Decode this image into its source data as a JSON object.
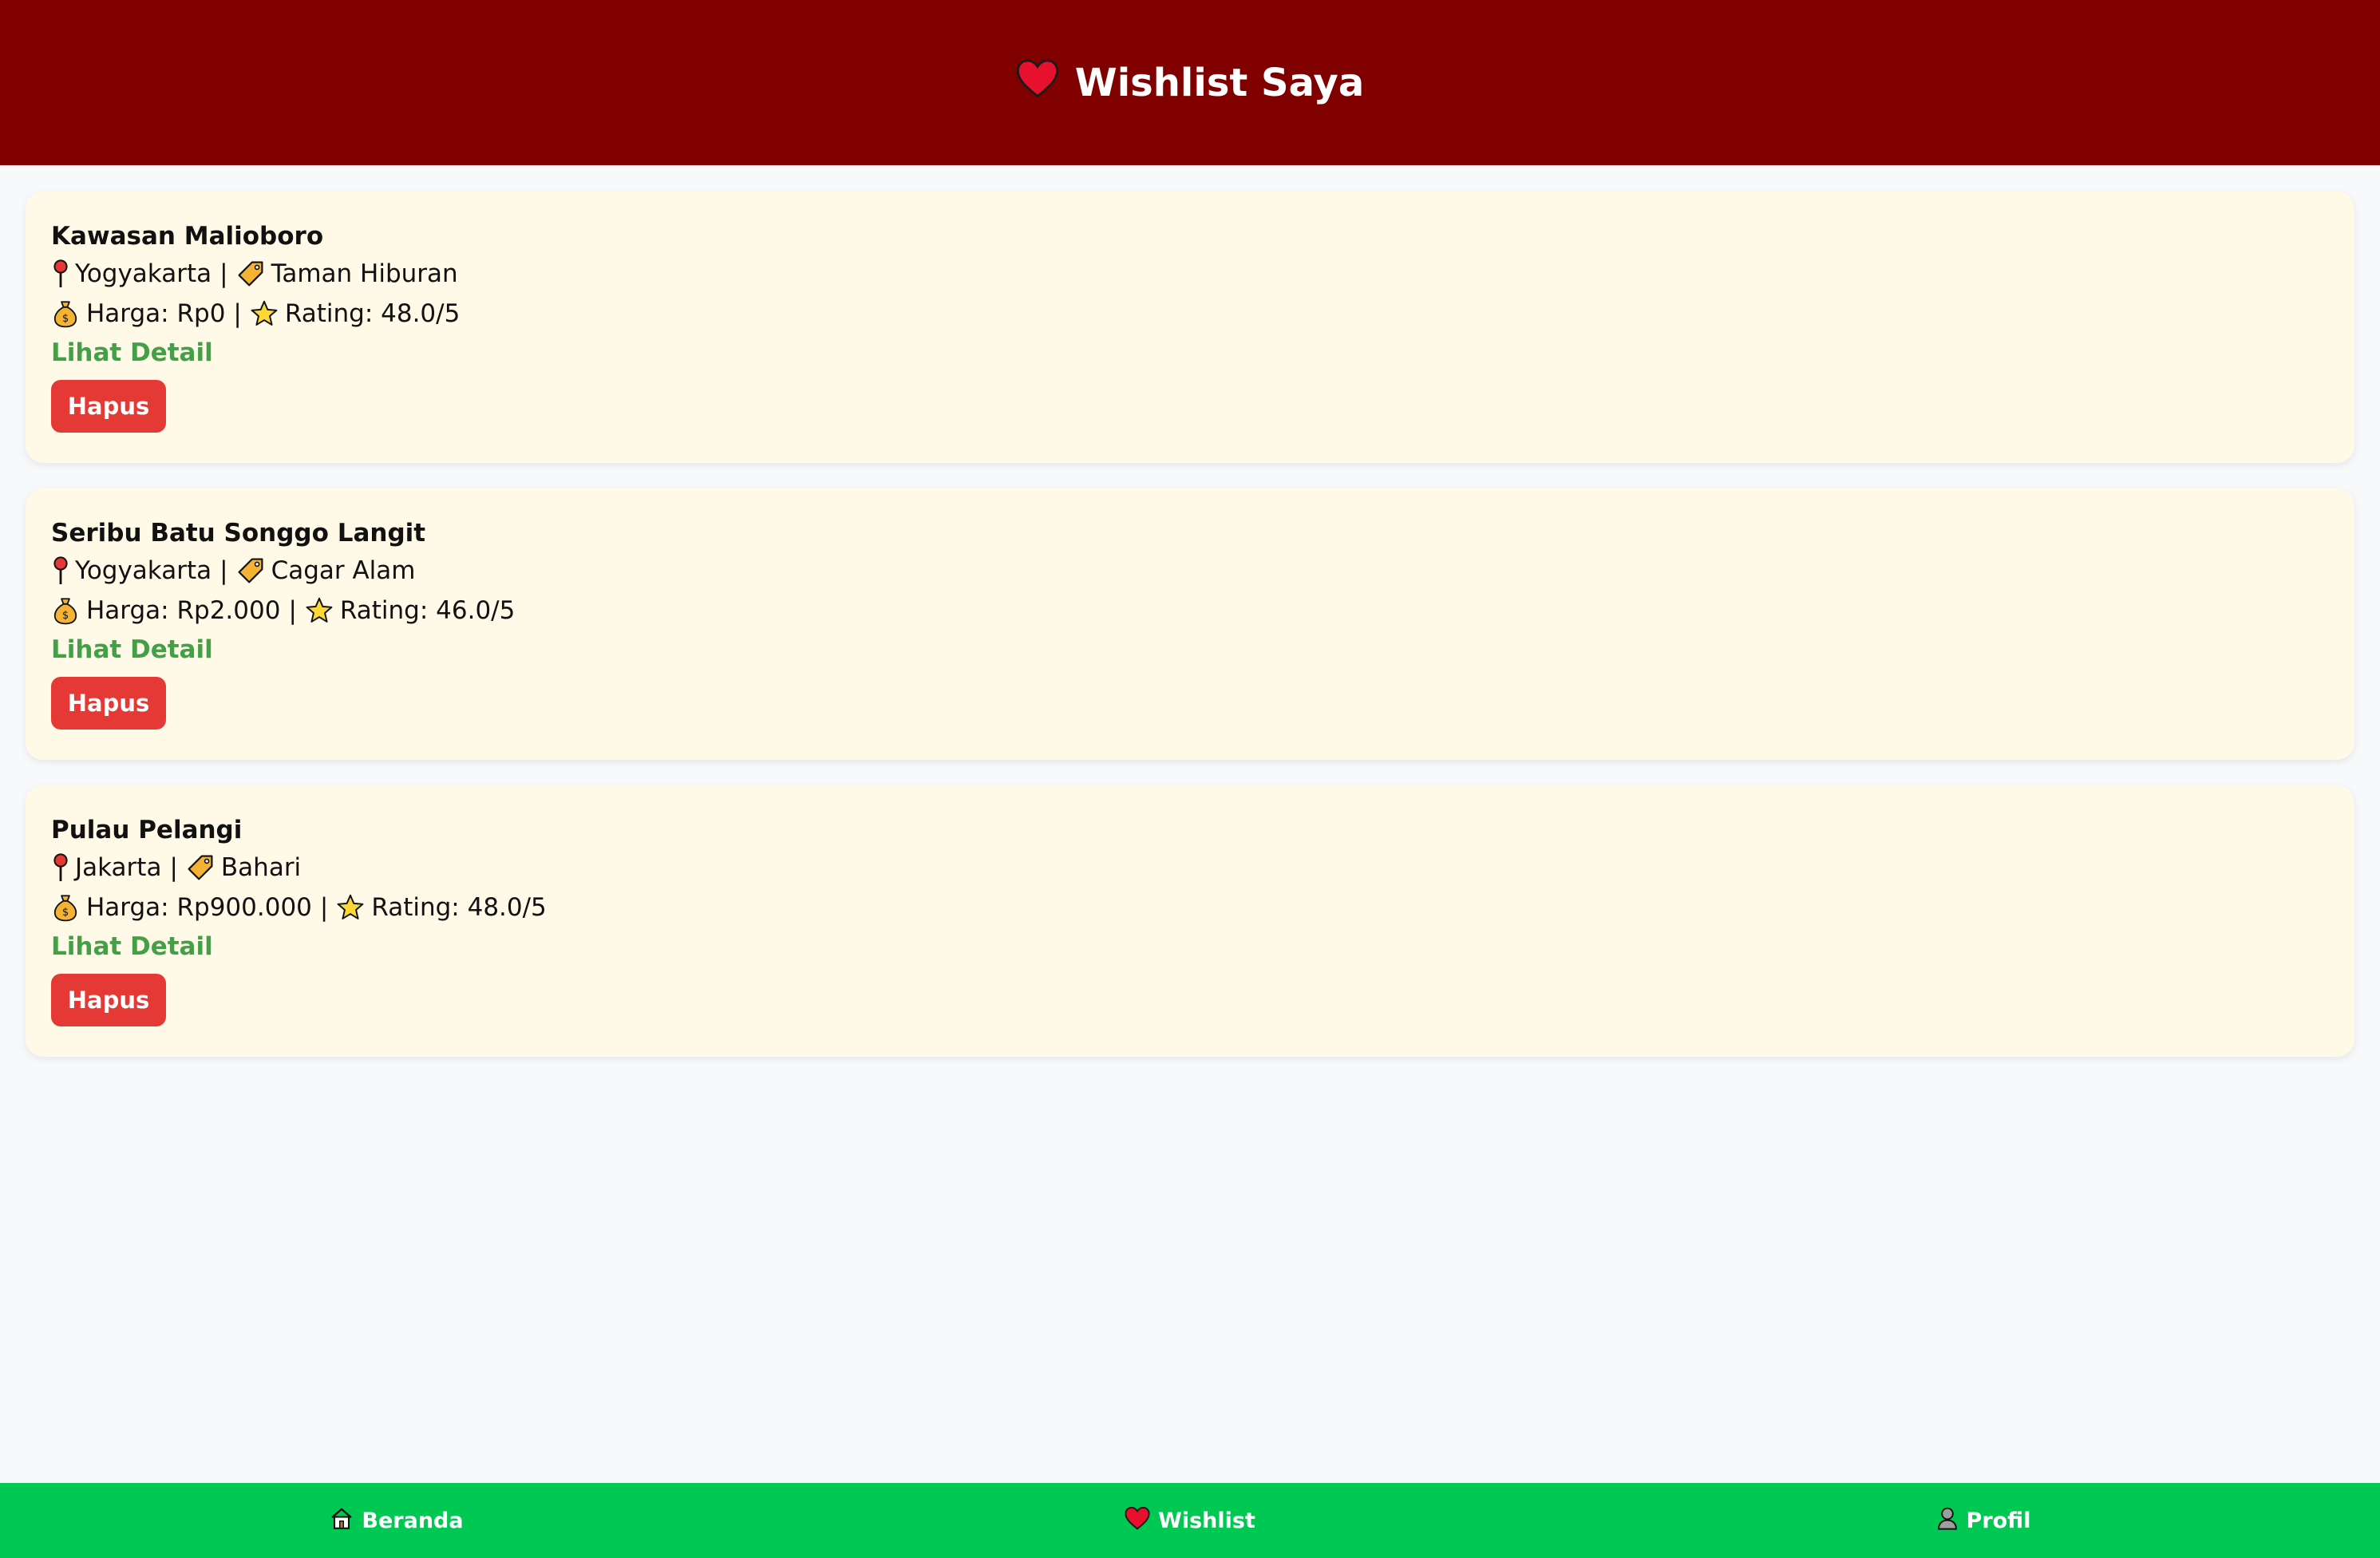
{
  "header": {
    "title": "Wishlist Saya",
    "icon": "heart-icon"
  },
  "wishlist": [
    {
      "name": "Kawasan Malioboro",
      "city": "Yogyakarta",
      "category": "Taman Hiburan",
      "price": "Harga: Rp0",
      "rating": "Rating: 48.0/5",
      "detail_label": "Lihat Detail",
      "delete_label": "Hapus"
    },
    {
      "name": "Seribu Batu Songgo Langit",
      "city": "Yogyakarta",
      "category": "Cagar Alam",
      "price": "Harga: Rp2.000",
      "rating": "Rating: 46.0/5",
      "detail_label": "Lihat Detail",
      "delete_label": "Hapus"
    },
    {
      "name": "Pulau Pelangi",
      "city": "Jakarta",
      "category": "Bahari",
      "price": "Harga: Rp900.000",
      "rating": "Rating: 48.0/5",
      "detail_label": "Lihat Detail",
      "delete_label": "Hapus"
    }
  ],
  "separator": "|",
  "nav": {
    "home": {
      "label": "Beranda",
      "icon": "house-icon"
    },
    "wishlist": {
      "label": "Wishlist",
      "icon": "heart-icon"
    },
    "profile": {
      "label": "Profil",
      "icon": "person-icon"
    }
  },
  "colors": {
    "header_bg": "#800000",
    "card_bg": "#fffae8",
    "link": "#43a047",
    "delete_button": "#e53935",
    "nav_bg": "#00c853"
  }
}
